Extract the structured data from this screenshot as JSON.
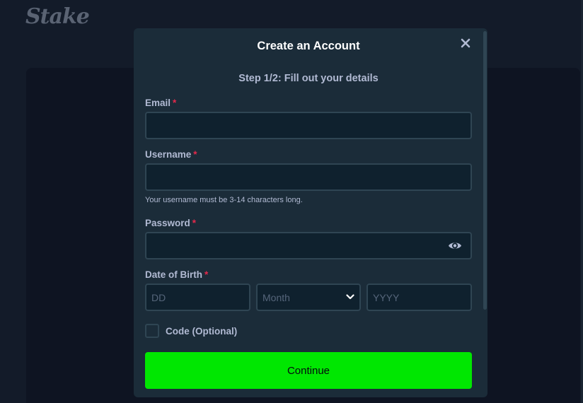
{
  "app": {
    "logo_text": "Stake"
  },
  "modal": {
    "title": "Create an Account",
    "step": "Step 1/2: Fill out your details",
    "close_icon": "close-icon"
  },
  "form": {
    "email": {
      "label": "Email",
      "required_mark": "*",
      "value": "",
      "placeholder": ""
    },
    "username": {
      "label": "Username",
      "required_mark": "*",
      "value": "",
      "placeholder": "",
      "hint": "Your username must be 3-14 characters long."
    },
    "password": {
      "label": "Password",
      "required_mark": "*",
      "value": "",
      "placeholder": "",
      "toggle_icon": "eye-icon"
    },
    "dob": {
      "label": "Date of Birth",
      "required_mark": "*",
      "day": {
        "value": "",
        "placeholder": "DD"
      },
      "month": {
        "selected": "Month"
      },
      "year": {
        "value": "",
        "placeholder": "YYYY"
      }
    },
    "code": {
      "label": "Code (Optional)",
      "checked": false
    },
    "continue_label": "Continue"
  },
  "colors": {
    "accent": "#00e701",
    "required": "#e4294b",
    "modal_bg": "#1b2c39",
    "input_bg": "#0f212e",
    "input_border": "#2f4553",
    "label": "#b1bad3"
  }
}
